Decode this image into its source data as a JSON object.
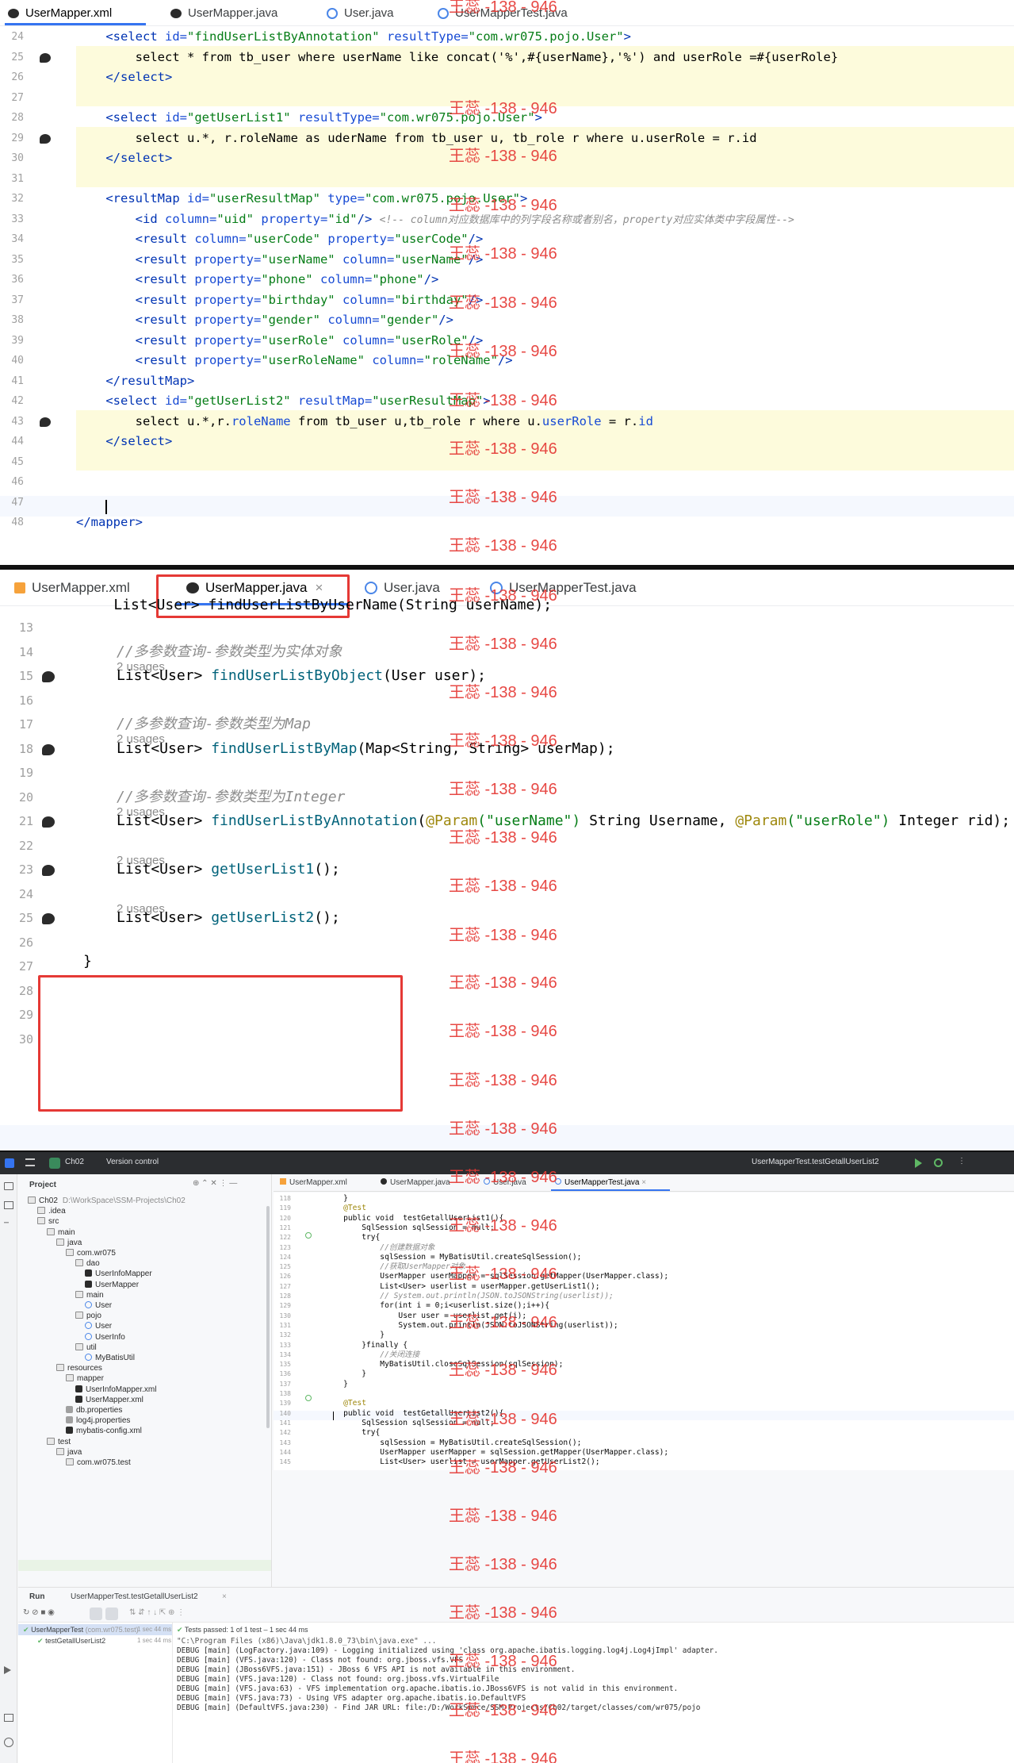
{
  "watermark": "王蕊 -138 - 946",
  "p1": {
    "tabs": [
      {
        "label": "UserMapper.xml",
        "icon": "mybatis-bird-icon",
        "active": true
      },
      {
        "label": "UserMapper.java",
        "icon": "mybatis-bird-icon"
      },
      {
        "label": "User.java",
        "icon": "java-class-icon"
      },
      {
        "label": "UserMapperTest.java",
        "icon": "java-class-icon"
      }
    ],
    "lines": [
      "24",
      "25",
      "26",
      "27",
      "28",
      "29",
      "30",
      "31",
      "32",
      "33",
      "34",
      "35",
      "36",
      "37",
      "38",
      "39",
      "40",
      "41",
      "42",
      "43",
      "44",
      "45",
      "46",
      "47",
      "48"
    ],
    "l24a": "    <",
    "l24b": "select ",
    "l24c": "id",
    "l24d": "=",
    "l24e": "\"findUserListByAnnotation\"",
    "l24f": " resultType",
    "l24g": "\"com.wr075.pojo.User\"",
    "l24h": ">",
    "l25": "        select * from tb_user where userName like concat('%',#{userName},'%') and userRole =#{userRole}",
    "l26": "    </select>",
    "l28a": "    <select ",
    "l28b": "id=",
    "l28c": "\"getUserList1\"",
    "l28d": " resultType=",
    "l28e": "\"com.wr075.pojo.User\"",
    "l28f": ">",
    "l29": "        select u.*, r.roleName as uderName from tb_user u, tb_role r where u.userRole = r.id",
    "l30": "    </select>",
    "l32a": "    <resultMap ",
    "l32b": "id=",
    "l32c": "\"userResultMap\"",
    "l32d": " type=",
    "l32e": "\"com.wr075.pojo.User\"",
    "l32f": ">",
    "l33a": "        <id ",
    "l33b": "column=",
    "l33c": "\"uid\"",
    "l33d": " property=",
    "l33e": "\"id\"",
    "l33f": "/> ",
    "l33g": "<!-- column对应数据库中的列字段名称或者别名，property对应实体类中字段属性-->",
    "l34": [
      [
        "column=",
        "\"userCode\""
      ],
      [
        "property=",
        "\"userCode\""
      ]
    ],
    "l35": [
      [
        "property=",
        "\"userName\""
      ],
      [
        "column=",
        "\"userName\""
      ]
    ],
    "l36": [
      [
        "property=",
        "\"phone\""
      ],
      [
        "column=",
        "\"phone\""
      ]
    ],
    "l37": [
      [
        "property=",
        "\"birthday\""
      ],
      [
        "column=",
        "\"birthday\""
      ]
    ],
    "l38": [
      [
        "property=",
        "\"gender\""
      ],
      [
        "column=",
        "\"gender\""
      ]
    ],
    "l39": [
      [
        "property=",
        "\"userRole\""
      ],
      [
        "column=",
        "\"userRole\""
      ]
    ],
    "l40": [
      [
        "property=",
        "\"userRoleName\""
      ],
      [
        "column=",
        "\"roleName\""
      ]
    ],
    "result_open": "        <result ",
    "result_close": "/>",
    "l41": "    </resultMap>",
    "l42a": "    <select ",
    "l42b": "id=",
    "l42c": "\"getUserList2\"",
    "l42d": " resultMap=",
    "l42e": "\"userResultMap\"",
    "l42f": ">",
    "l43a": "        select u.*,r.",
    "l43b": "roleName",
    "l43c": " from tb_user u,tb_role r where u.",
    "l43d": "userRole",
    "l43e": " = r.",
    "l43f": "id",
    "l44": "    </select>",
    "l48": "</mapper>"
  },
  "p2": {
    "tabs": [
      {
        "label": "UserMapper.xml",
        "icon": "xml-file-icon"
      },
      {
        "label": "UserMapper.java",
        "icon": "mybatis-bird-icon",
        "active": true,
        "close": "×"
      },
      {
        "label": "User.java",
        "icon": "java-class-icon"
      },
      {
        "label": "UserMapperTest.java",
        "icon": "java-class-icon"
      }
    ],
    "partial": "    List<User> findUserListByUserName(String userName);",
    "lines": [
      "13",
      "14",
      "15",
      "16",
      "17",
      "18",
      "19",
      "20",
      "21",
      "22",
      "23",
      "24",
      "25",
      "26",
      "27",
      "28",
      "29",
      "30"
    ],
    "c14": "//多参数查询-参数类型为实体对象",
    "c17": "//多参数查询-参数类型为Map",
    "c20": "//多参数查询-参数类型为Integer",
    "usage": "2 usages",
    "l15a": "List<User> ",
    "l15b": "findUserListByObject",
    "l15c": "(User user);",
    "l18a": "List<User> ",
    "l18b": "findUserListByMap",
    "l18c": "(Map<String, String> userMap);",
    "l21a": "List<User> ",
    "l21b": "findUserListByAnnotation",
    "l21c": "(",
    "l21d": "@Param",
    "l21e": "(\"userName\")",
    "l21f": " String Username, ",
    "l21g": "@Param",
    "l21h": "(\"userRole\")",
    "l21i": " Integer rid);",
    "l23a": "List<User> ",
    "l23b": "getUserList1",
    "l23c": "();",
    "l25a": "List<User> ",
    "l25b": "getUserList2",
    "l25c": "();",
    "l27": "}"
  },
  "p3": {
    "menu": [
      "Ch02",
      "Version control"
    ],
    "run_config": "UserMapperTest.testGetallUserList2",
    "project_label": "Project",
    "tree": [
      {
        "t": "Ch02",
        "sub": "D:\\WorkSpace\\SSM-Projects\\Ch02",
        "d": 0,
        "i": "folder"
      },
      {
        "t": ".idea",
        "d": 1,
        "i": "folder"
      },
      {
        "t": "src",
        "d": 1,
        "i": "folder"
      },
      {
        "t": "main",
        "d": 2,
        "i": "folder"
      },
      {
        "t": "java",
        "d": 3,
        "i": "folder"
      },
      {
        "t": "com.wr075",
        "d": 4,
        "i": "folder"
      },
      {
        "t": "dao",
        "d": 5,
        "i": "folder"
      },
      {
        "t": "UserInfoMapper",
        "d": 6,
        "i": "bird"
      },
      {
        "t": "UserMapper",
        "d": 6,
        "i": "bird"
      },
      {
        "t": "main",
        "d": 5,
        "i": "folder"
      },
      {
        "t": "User",
        "d": 6,
        "i": "class"
      },
      {
        "t": "pojo",
        "d": 5,
        "i": "folder"
      },
      {
        "t": "User",
        "d": 6,
        "i": "class"
      },
      {
        "t": "UserInfo",
        "d": 6,
        "i": "class"
      },
      {
        "t": "util",
        "d": 5,
        "i": "folder"
      },
      {
        "t": "MyBatisUtil",
        "d": 6,
        "i": "class"
      },
      {
        "t": "resources",
        "d": 3,
        "i": "folder"
      },
      {
        "t": "mapper",
        "d": 4,
        "i": "folder"
      },
      {
        "t": "UserInfoMapper.xml",
        "d": 5,
        "i": "bird"
      },
      {
        "t": "UserMapper.xml",
        "d": 5,
        "i": "bird"
      },
      {
        "t": "db.properties",
        "d": 4,
        "i": "prop"
      },
      {
        "t": "log4j.properties",
        "d": 4,
        "i": "prop"
      },
      {
        "t": "mybatis-config.xml",
        "d": 4,
        "i": "bird"
      },
      {
        "t": "test",
        "d": 2,
        "i": "folder"
      },
      {
        "t": "java",
        "d": 3,
        "i": "folder"
      },
      {
        "t": "com.wr075.test",
        "d": 4,
        "i": "folder"
      }
    ],
    "tabs": [
      {
        "label": "UserMapper.xml",
        "icon": "xml-file-icon"
      },
      {
        "label": "UserMapper.java",
        "icon": "mybatis-bird-icon"
      },
      {
        "label": "User.java",
        "icon": "java-class-icon"
      },
      {
        "label": "UserMapperTest.java",
        "icon": "java-class-icon",
        "active": true,
        "close": "×"
      }
    ],
    "lines": [
      "118",
      "119",
      "120",
      "121",
      "122",
      "123",
      "124",
      "125",
      "126",
      "127",
      "128",
      "129",
      "130",
      "131",
      "132",
      "133",
      "134",
      "135",
      "136",
      "137",
      "138",
      "139",
      "140",
      "141",
      "142",
      "143",
      "144",
      "145"
    ],
    "code": [
      "    }",
      "    @Test",
      "    public void  testGetallUserList1(){",
      "        SqlSession sqlSession = null;",
      "        try{",
      "            //创建数据对象",
      "            sqlSession = MyBatisUtil.createSqlSession();",
      "            //获取UserMapper对象",
      "            UserMapper userMapper = sqlSession.getMapper(UserMapper.class);",
      "            List<User> userlist = userMapper.getUserList1();",
      "            // System.out.println(JSON.toJSONString(userlist));",
      "            for(int i = 0;i<userlist.size();i++){",
      "                User user = userlist.get(i);",
      "                System.out.println(JSON.toJSONString(userlist));",
      "            }",
      "        }finally {",
      "            //关闭连接",
      "            MyBatisUtil.closeSqlSession(sqlSession);",
      "        }",
      "    }",
      "",
      "    @Test",
      "    public void  testGetallUserList2(){",
      "        SqlSession sqlSession = null;",
      "        try{",
      "            sqlSession = MyBatisUtil.createSqlSession();",
      "            UserMapper userMapper = sqlSession.getMapper(UserMapper.class);",
      "            List<User> userlist = userMapper.getUserList2();"
    ],
    "run_label": "Run",
    "run_tab": "UserMapperTest.testGetallUserList2",
    "tests_passed": "Tests passed: 1 of 1 test – 1 sec 44 ms",
    "test_root": "UserMapperTest",
    "test_root_pkg": "(com.wr075.test)",
    "test_root_time": "1 sec 44 ms",
    "test_child": "testGetallUserList2",
    "test_child_time": "1 sec 44 ms",
    "console": [
      "\"C:\\Program Files (x86)\\Java\\jdk1.8.0_73\\bin\\java.exe\" ...",
      "DEBUG [main] (LogFactory.java:109) - Logging initialized using 'class org.apache.ibatis.logging.log4j.Log4jImpl' adapter.",
      "DEBUG [main] (VFS.java:120) - Class not found: org.jboss.vfs.VFS",
      "DEBUG [main] (JBoss6VFS.java:151) - JBoss 6 VFS API is not available in this environment.",
      "DEBUG [main] (VFS.java:120) - Class not found: org.jboss.vfs.VirtualFile",
      "DEBUG [main] (VFS.java:63) - VFS implementation org.apache.ibatis.io.JBoss6VFS is not valid in this environment.",
      "DEBUG [main] (VFS.java:73) - Using VFS adapter org.apache.ibatis.io.DefaultVFS",
      "DEBUG [main] (DefaultVFS.java:230) - Find JAR URL: file:/D:/WorkSpace/SSM-Projects/Ch02/target/classes/com/wr075/pojo"
    ]
  }
}
